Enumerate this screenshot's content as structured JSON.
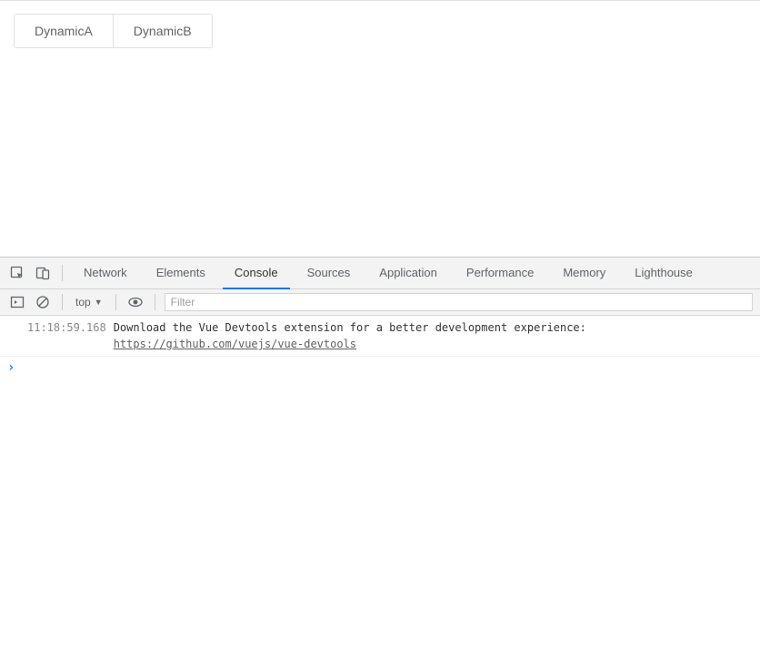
{
  "page": {
    "tabs": [
      {
        "label": "DynamicA"
      },
      {
        "label": "DynamicB"
      }
    ]
  },
  "devtools": {
    "tabs": [
      {
        "label": "Network",
        "active": false
      },
      {
        "label": "Elements",
        "active": false
      },
      {
        "label": "Console",
        "active": true
      },
      {
        "label": "Sources",
        "active": false
      },
      {
        "label": "Application",
        "active": false
      },
      {
        "label": "Performance",
        "active": false
      },
      {
        "label": "Memory",
        "active": false
      },
      {
        "label": "Lighthouse",
        "active": false
      }
    ],
    "console": {
      "context": "top",
      "filter_placeholder": "Filter",
      "log": {
        "timestamp": "11:18:59.168",
        "message": "Download the Vue Devtools extension for a better development experience: ",
        "link": "https://github.com/vuejs/vue-devtools"
      },
      "prompt": "›"
    }
  }
}
